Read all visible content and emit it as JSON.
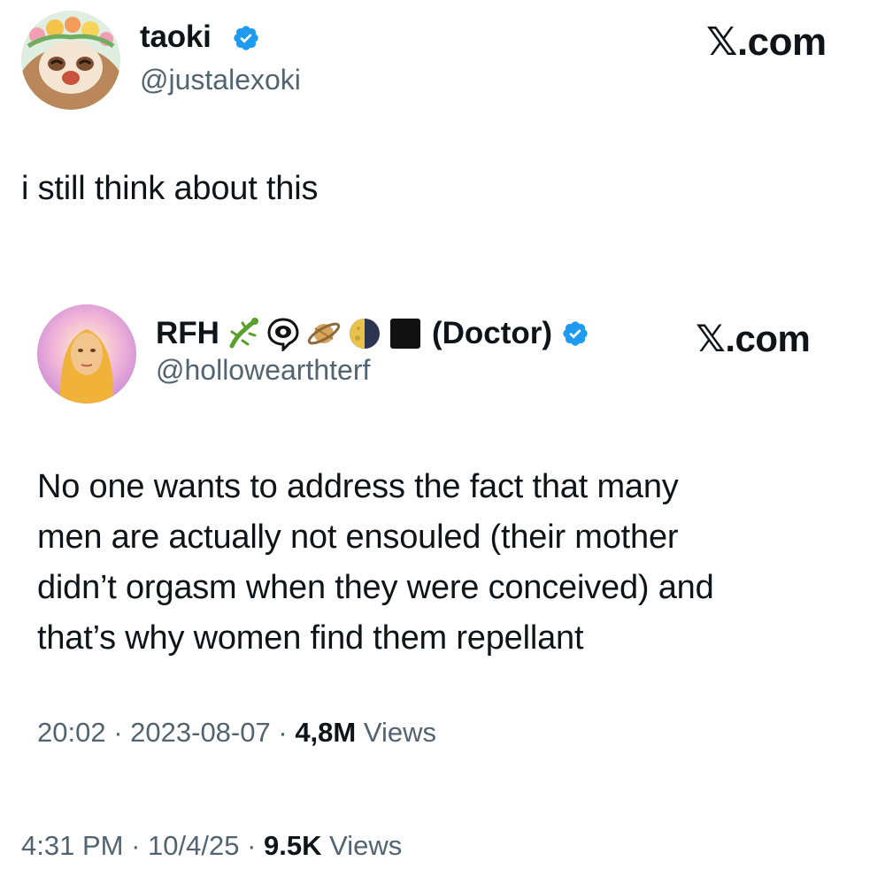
{
  "outer_tweet": {
    "name": "taoki",
    "handle": "@justalexoki",
    "brand": "𝕏.com",
    "text": "i still think about this",
    "time": "4:31 PM",
    "date": "10/4/25",
    "views_count": "9.5K",
    "views_label": "Views",
    "separator": "·",
    "verified_color": "#1d9bf0"
  },
  "quoted_tweet": {
    "name": "RFH",
    "emojis": [
      "lizard-icon",
      "eye-speech-icon",
      "ringed-planet-icon",
      "last-quarter-moon-icon",
      "black-square-icon"
    ],
    "name_suffix": "(Doctor)",
    "handle": "@hollowearthterf",
    "brand": "𝕏.com",
    "body_lines": [
      "No one wants to address the fact that many",
      "men are actually not ensouled (their mother",
      "didn’t orgasm when they were conceived) and",
      "that’s why women find them repellant"
    ],
    "time": "20:02",
    "date": "2023-08-07",
    "views_count": "4,8M",
    "views_label": "Views",
    "separator": "·",
    "verified_color": "#1d9bf0"
  }
}
